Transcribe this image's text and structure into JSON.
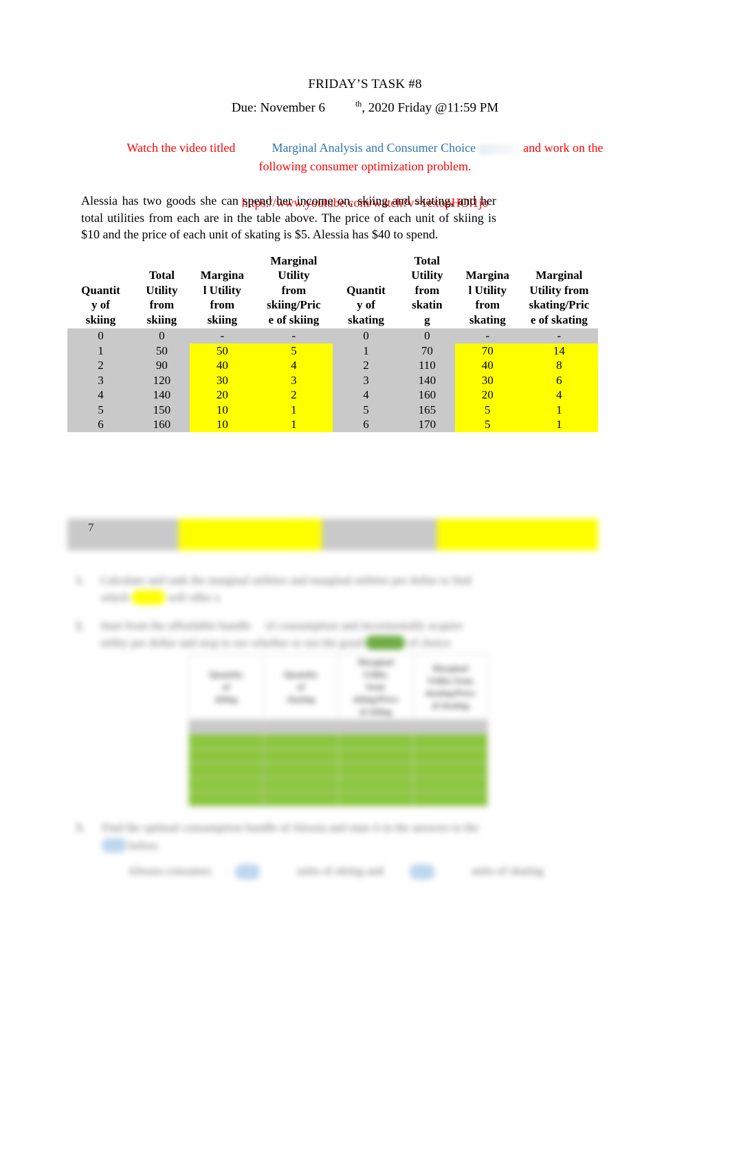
{
  "document": {
    "title": "FRIDAY’S TASK #8",
    "subtitle_prefix": "Due: November 6",
    "subtitle_sup": "th",
    "subtitle_suffix": ", 2020 Friday @11:59 PM"
  },
  "instruction": {
    "lead": "Watch the video titled",
    "video_title": "Marginal Analysis and Consumer Choice",
    "tail": "and work on the",
    "line2": "following consumer optimization problem.",
    "url": "https://www.youtube.com/watch?v=1exopHOl1jo",
    "color_red": "#FF0000",
    "color_link": "#2E74B5"
  },
  "problem": {
    "paragraph": "Alessia has two goods she can spend her income on, skiing and skating, and her total utilities from each are in the table above. The price of each unit of skiing is $10 and the price of each unit of skating is $5. Alessia has $40 to spend."
  },
  "main_table": {
    "headers": [
      "Quantit y of skiing",
      "Total Utility from skiing",
      "Margina l Utility from skiing",
      "Marginal Utility from skiing/Pric e of skiing",
      "Quantit y of skating",
      "Total Utility from skatin g",
      "Margina l Utility from skating",
      "Marginal Utility from skating/Pric e of skating"
    ],
    "header_lines": [
      [
        "Quantit",
        "y of",
        "skiing"
      ],
      [
        "Total",
        "Utility",
        "from",
        "skiing"
      ],
      [
        "Margina",
        "l Utility",
        "from",
        "skiing"
      ],
      [
        "Marginal",
        "Utility",
        "from",
        "skiing/Pric",
        "e of skiing"
      ],
      [
        "Quantit",
        "y of",
        "skating"
      ],
      [
        "Total",
        "Utility",
        "from",
        "skatin",
        "g"
      ],
      [
        "Margina",
        "l Utility",
        "from",
        "skating"
      ],
      [
        "Marginal",
        "Utility from",
        "skating/Pric",
        "e of skating"
      ]
    ],
    "rows": [
      [
        "0",
        "0",
        "-",
        "-",
        "0",
        "0",
        "-",
        "-"
      ],
      [
        "1",
        "50",
        "50",
        "5",
        "1",
        "70",
        "70",
        "14"
      ],
      [
        "2",
        "90",
        "40",
        "4",
        "2",
        "110",
        "40",
        "8"
      ],
      [
        "3",
        "120",
        "30",
        "3",
        "3",
        "140",
        "30",
        "6"
      ],
      [
        "4",
        "140",
        "20",
        "2",
        "4",
        "160",
        "20",
        "4"
      ],
      [
        "5",
        "150",
        "10",
        "1",
        "5",
        "165",
        "5",
        "1"
      ],
      [
        "6",
        "160",
        "10",
        "1",
        "6",
        "170",
        "5",
        "1"
      ]
    ],
    "highlight_columns": [
      2,
      3,
      6,
      7
    ],
    "highlight_color": "#FFFF00",
    "data_bg_color": "#C9C9C9"
  },
  "continued_table": {
    "row_label": "7",
    "note": "blurred continuation row"
  },
  "questions": [
    {
      "number": "1.",
      "text": "redacted"
    },
    {
      "number": "2.",
      "text": "redacted"
    },
    {
      "number": "3.",
      "text": "redacted"
    }
  ],
  "answer_table": {
    "header_lines": [
      [
        "Quantity",
        "of",
        "skiing"
      ],
      [
        "Quantity",
        "of",
        "skating"
      ],
      [
        "Marginal",
        "Utility",
        "from",
        "skiing/Price",
        "of skiing"
      ],
      [
        "Marginal",
        "Utility from",
        "skating/Price",
        "of skating"
      ]
    ],
    "highlight_color": "#8CC63E"
  },
  "colors": {
    "yellow": "#FFFF00",
    "green": "#8CC63E",
    "green_dark": "#70AD47",
    "blue": "#BDD7EE",
    "gray": "#C9C9C9",
    "red": "#FF0000",
    "link_blue": "#2E74B5"
  }
}
